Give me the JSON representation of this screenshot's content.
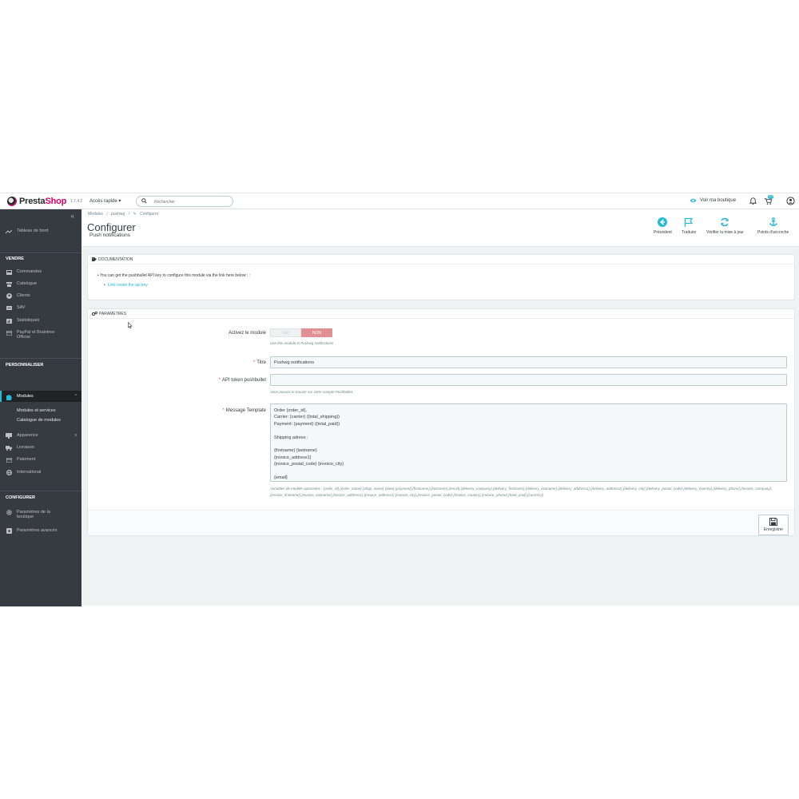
{
  "header": {
    "brand_pre": "Presta",
    "brand_post": "Shop",
    "version": "1.7.4.2",
    "quick_access": "Accès rapide ▾",
    "search_placeholder": "Rechercher",
    "view_shop": "Voir ma boutique",
    "notification_count": "19"
  },
  "sidebar": {
    "dashboard": "Tableau de bord",
    "sections": {
      "sell": "VENDRE",
      "customize": "PERSONNALISER",
      "configure": "CONFIGURER"
    },
    "sell_items": [
      "Commandes",
      "Catalogue",
      "Clients",
      "SAV",
      "Statistiques"
    ],
    "paypal_line1": "PayPal et Braintree",
    "paypal_line2": "Official",
    "modules": "Modules",
    "modules_sub": [
      "Modules et services",
      "Catalogue de modules"
    ],
    "customize_items": [
      "Apparence",
      "Livraison",
      "Paiement",
      "International"
    ],
    "shop_params_line1": "Paramètres de la",
    "shop_params_line2": "boutique",
    "advanced_params": "Paramètres avancés"
  },
  "breadcrumb": [
    "Modules",
    "/",
    "pushwg",
    "/",
    "Configurer"
  ],
  "page": {
    "title": "Configurer",
    "subtitle": "Push notifications"
  },
  "toolbar": {
    "back": "Précédent",
    "translate": "Traduire",
    "check_update": "Vérifier la mise à jour",
    "hooks": "Points d'accroche"
  },
  "documentation": {
    "heading": "DOCUMENTATION",
    "text": "• You can get the pushbullet API key to configure this module via the link here below : :",
    "link": "Link create the api key"
  },
  "settings": {
    "heading": "PARAMÈTRES",
    "enable_label": "Activez le module",
    "yes": "OUI",
    "no": "NON",
    "enable_help": "Use this module in Pushwg notifications",
    "title_label": "Titre",
    "title_value": "Pushwg notifications",
    "token_label": "API token pushbullet",
    "token_value": "",
    "token_help": "Vous pouvez le trouver sur votre compte Pushbullet.",
    "template_label": "Message Template",
    "template_value": "Order {order_id},\nCarrier: {carrier} ({total_shipping})\nPayment: {payment} ({total_paid})\n\nShipping adress :\n\n{firstname} {lastname}\n{invoice_address1}\n{invoice_postal_code} {invoice_city}\n\n{email}",
    "vars_help": "Variables de modèle autorisées : {order_id},{order_name},{shop_name},{date},{payment},{firstname},{lastname},{email},{delivery_company},{delivery_firstname},{delivery_lastname},{delivery_address1},{delivery_address2},{delivery_city},{delivery_postal_code},{delivery_country},{delivery_phone},{invoice_company},{invoice_firstname},{invoice_lastname},{invoice_address1},{invoice_address2},{invoice_city},{invoice_postal_code},{invoice_country},{invoice_phone},{total_paid},{currency}",
    "save": "Enregistrer"
  },
  "colors": {
    "sidebar_bg": "#363a41",
    "accent": "#25b9d7",
    "brand_pink": "#df0067",
    "switch_off": "#e08f95"
  }
}
